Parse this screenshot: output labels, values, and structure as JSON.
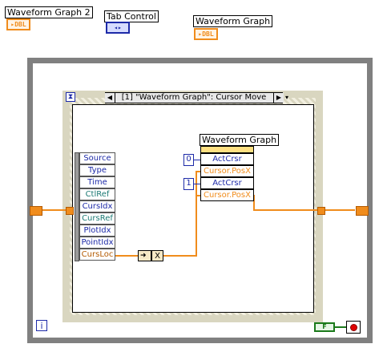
{
  "controls": {
    "waveform_graph_2": {
      "label": "Waveform Graph 2",
      "type": "DBL"
    },
    "tab_control": {
      "label": "Tab Control",
      "type": "◂▸"
    },
    "waveform_graph": {
      "label": "Waveform Graph",
      "type": "DBL"
    }
  },
  "event_structure": {
    "case_label": "[1] \"Waveform Graph\": Cursor Move",
    "timeout_icon": "hourglass-icon",
    "event_data": [
      "Source",
      "Type",
      "Time",
      "CtlRef",
      "CursIdx",
      "CursRef",
      "PlotIdx",
      "PointIdx",
      "CursLoc"
    ]
  },
  "property_node": {
    "title": "Waveform Graph",
    "rows": [
      "ActCrsr",
      "Cursor.PosX",
      "ActCrsr",
      "Cursor.PosX"
    ],
    "constants": [
      "0",
      "1"
    ]
  },
  "unbundle": {
    "field": "X"
  },
  "loop": {
    "iteration": "i",
    "bool_const": "F"
  },
  "colors": {
    "orange_wire": "#f08c1c",
    "blue_int": "#1d2aa8",
    "loop_border": "#808080"
  }
}
